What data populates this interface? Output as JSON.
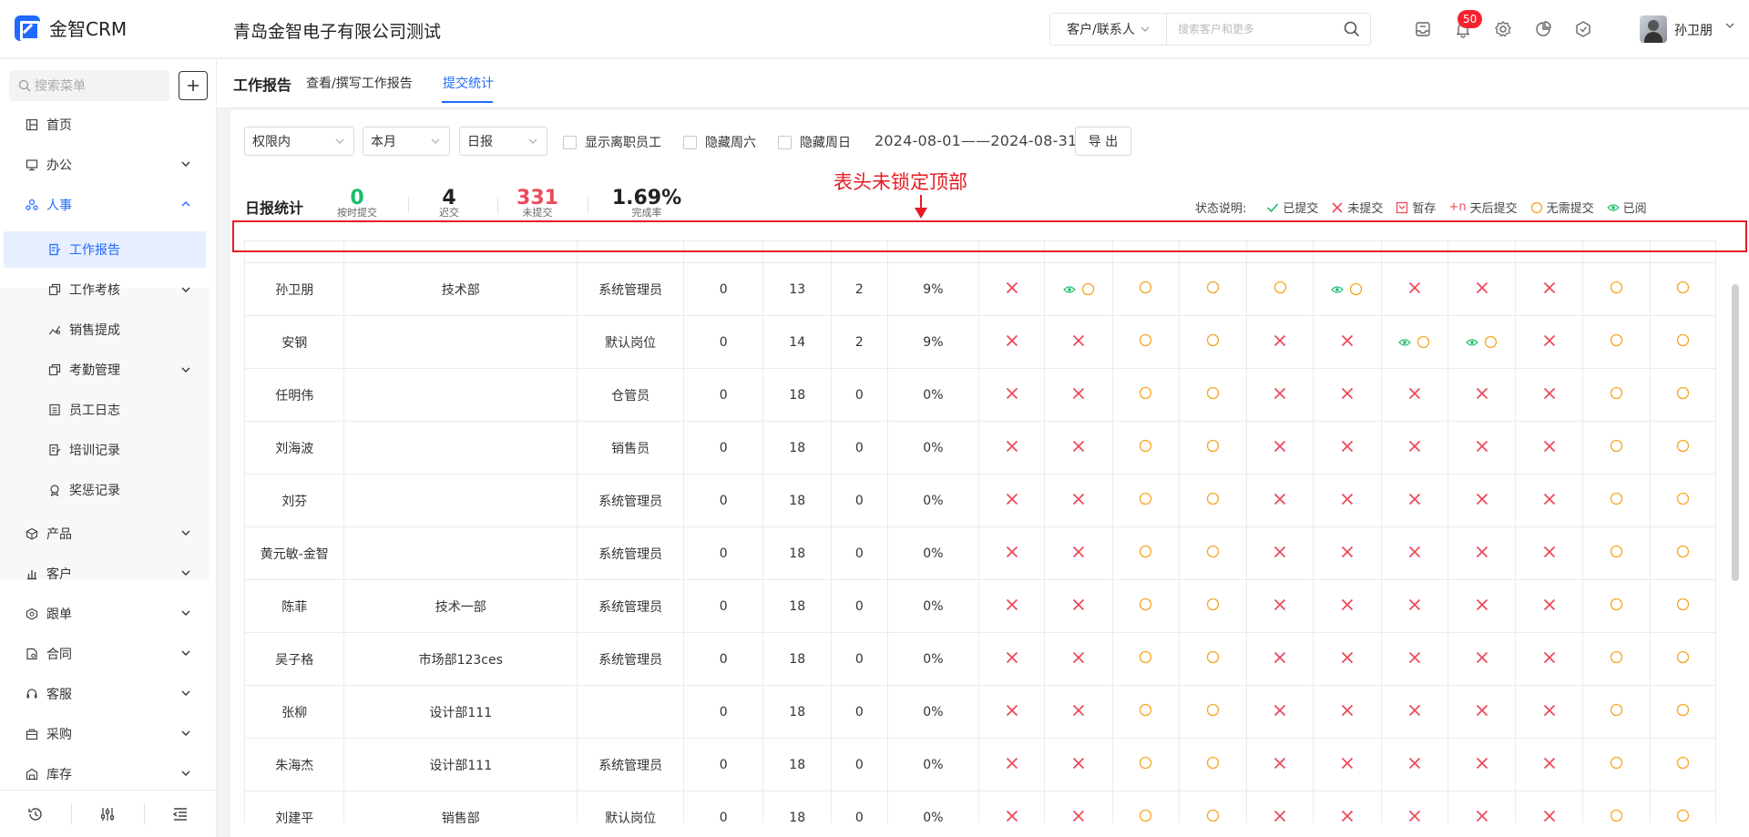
{
  "app": {
    "brand": "金智CRM",
    "company": "青岛金智电子有限公司测试",
    "search_type": "客户/联系人",
    "search_placeholder": "搜索客户和更多",
    "notification_count": "50",
    "user_name": "孙卫朋"
  },
  "sidebar": {
    "search_placeholder": "搜索菜单",
    "items": [
      {
        "label": "首页",
        "icon": "home-icon"
      },
      {
        "label": "办公",
        "icon": "office-icon"
      },
      {
        "label": "人事",
        "icon": "hr-icon"
      }
    ],
    "sub_items": [
      {
        "label": "工作报告",
        "icon": "report-icon"
      },
      {
        "label": "工作考核",
        "icon": "assessment-icon"
      },
      {
        "label": "销售提成",
        "icon": "commission-icon"
      },
      {
        "label": "考勤管理",
        "icon": "attendance-icon"
      },
      {
        "label": "员工日志",
        "icon": "log-icon"
      },
      {
        "label": "培训记录",
        "icon": "training-icon"
      },
      {
        "label": "奖惩记录",
        "icon": "award-icon"
      }
    ],
    "lower_items": [
      {
        "label": "产品",
        "icon": "product-icon"
      },
      {
        "label": "客户",
        "icon": "customer-icon"
      },
      {
        "label": "跟单",
        "icon": "followup-icon"
      },
      {
        "label": "合同",
        "icon": "contract-icon"
      },
      {
        "label": "客服",
        "icon": "service-icon"
      },
      {
        "label": "采购",
        "icon": "purchase-icon"
      },
      {
        "label": "库存",
        "icon": "inventory-icon"
      }
    ]
  },
  "page": {
    "title": "工作报告",
    "tabs": [
      "查看/撰写工作报告",
      "提交统计"
    ],
    "active_tab": 1
  },
  "filters": {
    "scope": "权限内",
    "period": "本月",
    "report_type": "日报",
    "checkboxes": [
      "显示离职员工",
      "隐藏周六",
      "隐藏周日"
    ],
    "date_range": "2024-08-01——2024-08-31",
    "export_label": "导 出"
  },
  "stats": {
    "title": "日报统计",
    "items": [
      {
        "value": "0",
        "label": "按时提交",
        "color": "#19be6b"
      },
      {
        "value": "4",
        "label": "迟交",
        "color": "#222222"
      },
      {
        "value": "331",
        "label": "未提交",
        "color": "#ed4a5b"
      },
      {
        "value": "1.69%",
        "label": "完成率",
        "color": "#222222"
      }
    ]
  },
  "annotation": "表头未锁定顶部",
  "legend": {
    "label": "状态说明:",
    "items": [
      {
        "icon": "check-icon",
        "text": "已提交",
        "color": "#19be6b"
      },
      {
        "icon": "cross-icon",
        "text": "未提交",
        "color": "#ed4a5b"
      },
      {
        "icon": "draft-icon",
        "text": "暂存",
        "color": "#ed4a5b"
      },
      {
        "icon": "late-icon",
        "prefix": "+n",
        "text": "天后提交",
        "color": "#ed4a5b"
      },
      {
        "icon": "circle-icon",
        "text": "无需提交",
        "color": "#f5a623"
      },
      {
        "icon": "eye-icon",
        "text": "已阅",
        "color": "#19be6b"
      }
    ]
  },
  "table": {
    "rows": [
      {
        "name": "孙卫朋",
        "dept": "技术部",
        "role": "系统管理员",
        "ontime": "0",
        "missing": "13",
        "late": "2",
        "rate": "9%",
        "days": [
          "x",
          "eo",
          "o",
          "o",
          "o",
          "eo",
          "x",
          "x",
          "x",
          "o",
          "o"
        ]
      },
      {
        "name": "安钢",
        "dept": "",
        "role": "默认岗位",
        "ontime": "0",
        "missing": "14",
        "late": "2",
        "rate": "9%",
        "days": [
          "x",
          "x",
          "o",
          "o",
          "x",
          "x",
          "eo",
          "eo",
          "x",
          "o",
          "o"
        ]
      },
      {
        "name": "任明伟",
        "dept": "",
        "role": "仓管员",
        "ontime": "0",
        "missing": "18",
        "late": "0",
        "rate": "0%",
        "days": [
          "x",
          "x",
          "o",
          "o",
          "x",
          "x",
          "x",
          "x",
          "x",
          "o",
          "o"
        ]
      },
      {
        "name": "刘海波",
        "dept": "",
        "role": "销售员",
        "ontime": "0",
        "missing": "18",
        "late": "0",
        "rate": "0%",
        "days": [
          "x",
          "x",
          "o",
          "o",
          "x",
          "x",
          "x",
          "x",
          "x",
          "o",
          "o"
        ]
      },
      {
        "name": "刘芬",
        "dept": "",
        "role": "系统管理员",
        "ontime": "0",
        "missing": "18",
        "late": "0",
        "rate": "0%",
        "days": [
          "x",
          "x",
          "o",
          "o",
          "x",
          "x",
          "x",
          "x",
          "x",
          "o",
          "o"
        ]
      },
      {
        "name": "黄元敏-金智",
        "dept": "",
        "role": "系统管理员",
        "ontime": "0",
        "missing": "18",
        "late": "0",
        "rate": "0%",
        "days": [
          "x",
          "x",
          "o",
          "o",
          "x",
          "x",
          "x",
          "x",
          "x",
          "o",
          "o"
        ]
      },
      {
        "name": "陈菲",
        "dept": "技术一部",
        "role": "系统管理员",
        "ontime": "0",
        "missing": "18",
        "late": "0",
        "rate": "0%",
        "days": [
          "x",
          "x",
          "o",
          "o",
          "x",
          "x",
          "x",
          "x",
          "x",
          "o",
          "o"
        ]
      },
      {
        "name": "吴子格",
        "dept": "市场部123ces",
        "role": "系统管理员",
        "ontime": "0",
        "missing": "18",
        "late": "0",
        "rate": "0%",
        "days": [
          "x",
          "x",
          "o",
          "o",
          "x",
          "x",
          "x",
          "x",
          "x",
          "o",
          "o"
        ]
      },
      {
        "name": "张柳",
        "dept": "设计部111",
        "role": "",
        "ontime": "0",
        "missing": "18",
        "late": "0",
        "rate": "0%",
        "days": [
          "x",
          "x",
          "o",
          "o",
          "x",
          "x",
          "x",
          "x",
          "x",
          "o",
          "o"
        ]
      },
      {
        "name": "朱海杰",
        "dept": "设计部111",
        "role": "系统管理员",
        "ontime": "0",
        "missing": "18",
        "late": "0",
        "rate": "0%",
        "days": [
          "x",
          "x",
          "o",
          "o",
          "x",
          "x",
          "x",
          "x",
          "x",
          "o",
          "o"
        ]
      },
      {
        "name": "刘建平",
        "dept": "销售部",
        "role": "默认岗位",
        "ontime": "0",
        "missing": "18",
        "late": "0",
        "rate": "0%",
        "days": [
          "x",
          "x",
          "o",
          "o",
          "x",
          "x",
          "x",
          "x",
          "x",
          "o",
          "o"
        ]
      }
    ]
  },
  "colors": {
    "accent": "#1f6bff",
    "red": "#ed4a5b",
    "orange": "#f5a623",
    "green": "#19be6b"
  }
}
